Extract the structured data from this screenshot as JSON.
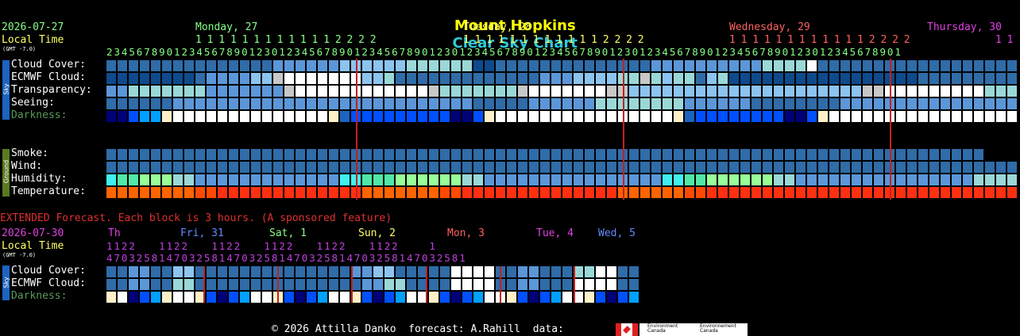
{
  "header": {
    "title_part1": "Mount Hopkins",
    "title_part2": "Clear Sky Chart",
    "title_color1": "#ffff00",
    "title_color2": "#2ec8d8"
  },
  "main": {
    "date": "2026-07-27",
    "local_time_label": "Local Time",
    "gmt_label": "(GMT -7.0)",
    "day_labels": [
      {
        "text": "Monday, 27",
        "color": "#88ff88"
      },
      {
        "text": "Tuesday, 28",
        "color": "#ffff66"
      },
      {
        "text": "Wednesday, 29",
        "color": "#ff6060"
      },
      {
        "text": "Thursday, 30",
        "color": "#e040e0"
      }
    ],
    "hour_tens": "1 1 1 1 1 1 1 1 1 1 1 1 2 2 2 2",
    "hours_line": "2 3 4 5 6 7 8 9 0 1 2 3 4 5 6 7 8 9 0 1 2 3 0 1 2 3 4 5 6 7 8 9 0 1 2 3 4 5 6 7 8 9 0 1 2 3 0 1 2 3 4 5 6 7 8 9 0 1 2 3 4 5 6 7 8 9 0 1 2 3 0 1 2 3 4 5 6 7 8 9 0 1 2 3 4 5 6 7 8 9 0 1 2 3 0 1 2 3 4 5 6 7 8 9 0 1",
    "thursday_tens": "1 1",
    "sky_side_label": "Sky",
    "ground_side_label": "Ground",
    "sky_rows": [
      "Cloud Cover:",
      "ECMWF Cloud:",
      "Transparency:",
      "Seeing:",
      "Darkness:"
    ],
    "ground_rows": [
      "Smoke:",
      "Wind:",
      "Humidity:",
      "Temperature:"
    ]
  },
  "extended": {
    "banner": "EXTENDED Forecast. Each block is 3 hours. (A sponsored feature)",
    "date": "2026-07-30",
    "local_time_label": "Local Time",
    "gmt_label": "(GMT -7.0)",
    "day_labels": [
      {
        "text": "Th",
        "color": "#e040e0"
      },
      {
        "text": "Fri, 31",
        "color": "#6688ff"
      },
      {
        "text": "Sat, 1",
        "color": "#88ff88"
      },
      {
        "text": "Sun, 2",
        "color": "#ffff66"
      },
      {
        "text": "Mon, 3",
        "color": "#ff6060"
      },
      {
        "text": "Tue, 4",
        "color": "#e040e0"
      },
      {
        "text": "Wed, 5",
        "color": "#6688ff"
      }
    ],
    "tens_line": "1 1 2 2       1 1 2 2       1 1 2 2       1 1 2 2       1 1 2 2       1 1 2 2         1",
    "hours_line": "4 7 0 3 2 5 8 1 4 7 0 3 2 5 8 1 4 7 0 3 2 5 8 1 4 7 0 3 2 5 8 1 4 7 0 3 2 5 8 1 4 7 0 3 2 5 8 1",
    "sky_side_label": "Sky",
    "rows": [
      "Cloud Cover:",
      "ECMWF Cloud:",
      "Darkness:"
    ]
  },
  "footer": {
    "text": "© 2026 Attilla Danko  forecast: A.Rahill  data:",
    "env_en": "Environment Canada",
    "env_fr": "Environnement Canada"
  },
  "chart_data": {
    "type": "heatmap",
    "title": "Mount Hopkins Clear Sky Chart",
    "palette": {
      "D": "#0e4a8c",
      "M": "#2f6ca8",
      "L": "#5b97d8",
      "P": "#8cc4f0",
      "T": "#9ad8d8",
      "W": "#ffffff",
      "G": "#c8c8c8",
      "Y": "#1c64c0",
      "R": "#ff3010",
      "O": "#ff6400",
      "A": "#ff4a00",
      "C": "#40f0f0",
      "E": "#50e8a8",
      "N": "#98ff98",
      "K": "#000078",
      "B": "#0050ff",
      "S": "#00a0ff",
      "Q": "#fff0c8",
      "U": "#000000"
    },
    "hourly_rows": [
      {
        "name": "Cloud Cover",
        "codes": "MMMMMMMMMMMMMMMLLLLLLPPPPPPTTTTTTDDMMMMMMMMMMMMMMLLLLLLLLLLTTTTWMMMMMMMMMMMMMMMMMMMMMMMLLLLLLLTTTTTTTTTTTTTTTTMMMMMMMMMM"
      },
      {
        "name": "ECMWF Cloud",
        "codes": "DDDDDDDDMLLLLPPGWWWWWWWPPTMMMMMMMMMMMMMLLLPPPPTTGTPTTMPTDDDDDDDDDDDDDDDDDMMMMMMMMMMMMMMLLLLLLLLLLLLLLLLLLLLLLLLLLLLLLLLLLL"
      },
      {
        "name": "Transparency",
        "codes": "LLTTTTTTTLLLLLLLGWWWWWWWWWWWWGTTTTTTTGWWWWWWWGGPPPPPPPPPPPPPPPPPPPPPGGWWWWWWWWWTTTTWWWWWWWWWWWWTTTTTTTTTTLLLLLLLLL"
      },
      {
        "name": "Seeing",
        "codes": "MMMMMMLLLLLLLLLLLLLLLLLLLLLLLLLLLMMMMMLLLLLLTTTTTTTTLLLLLLMMMMMMMMLLLLLLLLLLLLLLLLTTTTTLLLLLLLLTTTTTLLLLMMMMMM"
      },
      {
        "name": "Darkness",
        "codes": "KKBSSQWWWWWWWWWWWWWWQYBBBBBBBBBKKBQWWWWWWWWWWWWWWWWQYBBBBBBBBKKBQWWWWWWWWWWWWWWWWWQYBBBBBBBBKKBQWWWWWWWWWWW"
      },
      {
        "name": "Smoke",
        "codes": "MMMMMMMMMMMMMMMMMMMMMMMMMMMMMMMMMMMMMMMMMMMMMMMMMMMMMMMMMMMMMMMMMMMMMMMMMMMMMMM"
      },
      {
        "name": "Wind",
        "codes": "MMMMMMMMMMMMMMMMMMMMMMMMMMMMMMMMMMMMMMMMMMMMMMMMMMMMMMMMMMMMMMMMMMMMMMMMMMMMMMMMMMMMMMMMMMMMDDDDMMMMMMMMMMMM"
      },
      {
        "name": "Humidity",
        "codes": "CEENNNTTLLLLLLLLLLLLLCCEEENNNNNNTTLLLLLLLLLLLLLLLLCCEENNNNNNTTLLLLLLLLLLLLLLLLTTTTTTLLLLLLLLLLLLLLTTTTTTLLLMM"
      },
      {
        "name": "Temperature",
        "codes": "OOOOOOOOAARRRRRRRRRRRRROOOOOOOAARRRRRRRRRRRRRROOOOOOAARRRRRRRRRRRRRRRRRRRRRRRRRRRRRRRRRRRRRRRRRRRRRRRRRRRRR"
      }
    ],
    "extended_rows": [
      {
        "name": "Cloud Cover",
        "codes": "MMLLMMPPMMMMMMMMMMMMMMLLPPMMMMMWWWWMMLLMMMTTWWMMMPPMMMMMMWWWWMMLL"
      },
      {
        "name": "ECMWF Cloud",
        "codes": "MMLLMMTTMMMMMMMMMMMMMMMLLTTMMMMWWWWMMLLMMMWWWWMMTTMMMMMMWWWWMMMM"
      },
      {
        "name": "Darkness",
        "codes": "QWKBSQWWQBKBSWWQBKBSWWQBKBSWWQBKBSWWQBKBSWWQBKBSWWQBKBSWWW"
      }
    ],
    "midnight_columns": [
      22,
      46,
      70
    ],
    "extended_midnight_columns": [
      7,
      15,
      23,
      31,
      39,
      47
    ]
  }
}
